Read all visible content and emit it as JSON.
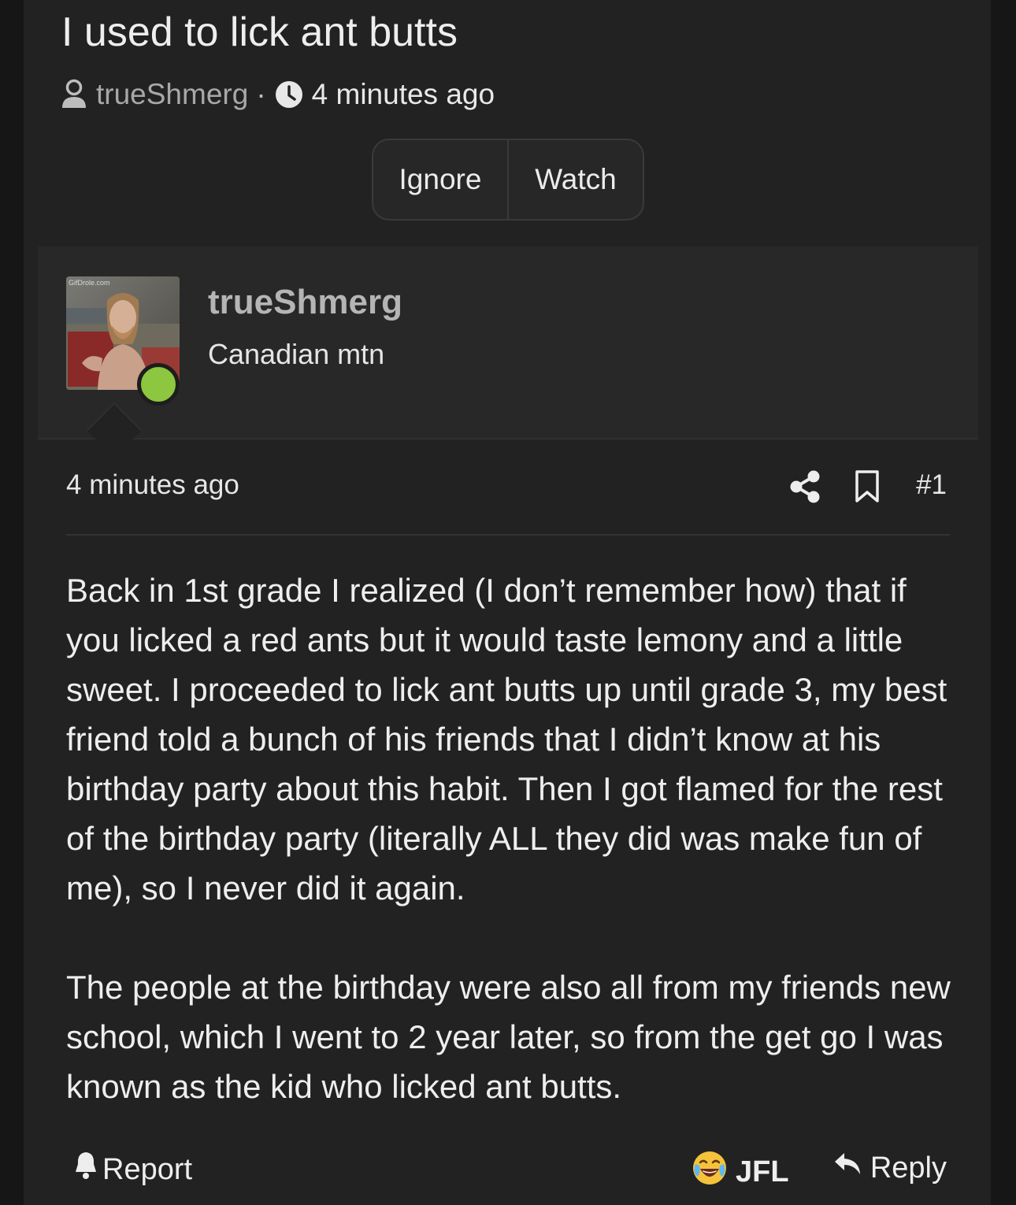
{
  "thread": {
    "title": "I used to lick ant butts",
    "author": "trueShmerg",
    "separator": "·",
    "time": "4 minutes ago"
  },
  "thread_actions": {
    "ignore_label": "Ignore",
    "watch_label": "Watch"
  },
  "user": {
    "name": "trueShmerg",
    "title": "Canadian mtn",
    "avatar_watermark": "GifDrole.com",
    "status_color": "#8dc63f"
  },
  "post": {
    "time": "4 minutes ago",
    "number": "#1",
    "paragraphs": [
      "Back in 1st grade I realized (I don’t remember how) that if you licked a red ants but it would taste lemony and a little sweet. I proceeded to lick ant butts up until grade 3, my best friend told a bunch of his friends that I didn’t know at his birthday party about this habit. Then I got flamed for the rest of the birthday party (literally ALL they did was make fun of me), so I never did it again.",
      "The people at the birthday were also all from my friends new school, which I went to 2 year later, so from the get go I was known as the kid who licked ant butts."
    ]
  },
  "post_actions": {
    "report_label": "Report",
    "reaction_label": "JFL",
    "reply_label": "Reply"
  },
  "icons": {
    "author": "user-icon",
    "time": "clock-icon",
    "share": "share-icon",
    "bookmark": "bookmark-icon",
    "report": "bell-icon",
    "reaction": "crying-laughing-emoji-icon",
    "reply": "reply-arrow-icon"
  }
}
